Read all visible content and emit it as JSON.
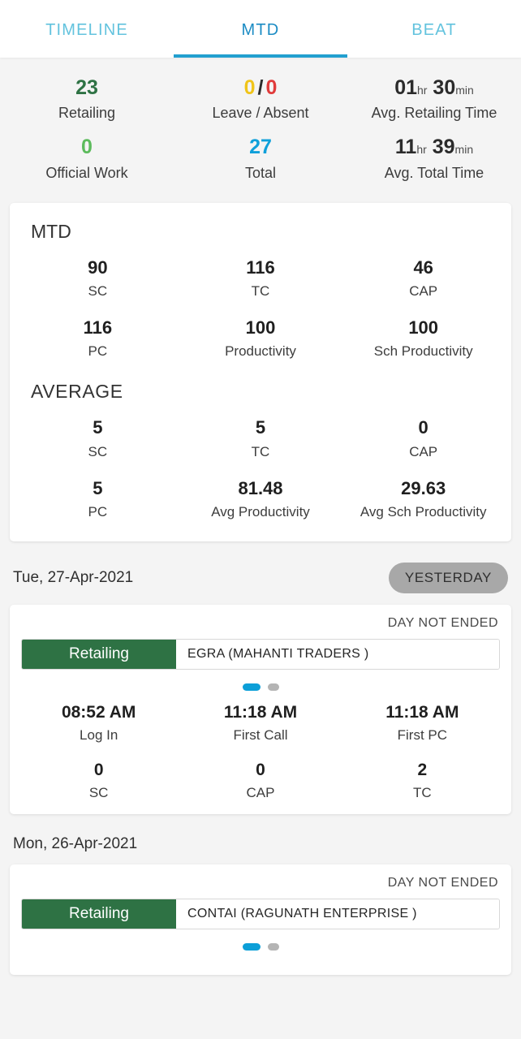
{
  "tabs": [
    {
      "label": "TIMELINE",
      "active": false
    },
    {
      "label": "MTD",
      "active": true
    },
    {
      "label": "BEAT",
      "active": false
    }
  ],
  "summary": {
    "retailing": {
      "value": "23",
      "label": "Retailing",
      "color": "#2e7244"
    },
    "leave_absent": {
      "leave": "0",
      "separator": "/",
      "absent": "0",
      "label": "Leave / Absent",
      "leave_color": "#f0c419",
      "absent_color": "#e03b3b"
    },
    "avg_retailing_time": {
      "hours": "01",
      "hours_unit": "hr",
      "minutes": "30",
      "minutes_unit": "min",
      "label": "Avg. Retailing Time"
    },
    "official_work": {
      "value": "0",
      "label": "Official Work",
      "color": "#5cbb5c"
    },
    "total": {
      "value": "27",
      "label": "Total",
      "color": "#0fa0da"
    },
    "avg_total_time": {
      "hours": "11",
      "hours_unit": "hr",
      "minutes": "39",
      "minutes_unit": "min",
      "label": "Avg. Total Time"
    }
  },
  "mtd_card": {
    "title": "MTD",
    "metrics": [
      {
        "value": "90",
        "label": "SC"
      },
      {
        "value": "116",
        "label": "TC"
      },
      {
        "value": "46",
        "label": "CAP"
      },
      {
        "value": "116",
        "label": "PC"
      },
      {
        "value": "100",
        "label": "Productivity"
      },
      {
        "value": "100",
        "label": "Sch Productivity"
      }
    ],
    "average_title": "AVERAGE",
    "average_metrics": [
      {
        "value": "5",
        "label": "SC"
      },
      {
        "value": "5",
        "label": "TC"
      },
      {
        "value": "0",
        "label": "CAP"
      },
      {
        "value": "5",
        "label": "PC"
      },
      {
        "value": "81.48",
        "label": "Avg Productivity"
      },
      {
        "value": "29.63",
        "label": "Avg Sch Productivity"
      }
    ]
  },
  "days": [
    {
      "date": "Tue, 27-Apr-2021",
      "badge": "YESTERDAY",
      "status": "DAY NOT ENDED",
      "visit_type": "Retailing",
      "visit_name": "EGRA (MAHANTI TRADERS )",
      "dots": [
        {
          "active": true
        },
        {
          "active": false
        }
      ],
      "metrics": [
        {
          "value": "08:52 AM",
          "label": "Log In"
        },
        {
          "value": "11:18 AM",
          "label": "First Call"
        },
        {
          "value": "11:18 AM",
          "label": "First PC"
        },
        {
          "value": "0",
          "label": "SC"
        },
        {
          "value": "0",
          "label": "CAP"
        },
        {
          "value": "2",
          "label": "TC"
        }
      ]
    },
    {
      "date": "Mon, 26-Apr-2021",
      "badge": "",
      "status": "DAY NOT ENDED",
      "visit_type": "Retailing",
      "visit_name": "CONTAI (RAGUNATH ENTERPRISE )",
      "dots": [
        {
          "active": true
        },
        {
          "active": false
        }
      ],
      "metrics": []
    }
  ],
  "colors": {
    "page_background": "#f4f4f4",
    "card_background": "#ffffff",
    "tab_active": "#1c8cc4",
    "tab_inactive": "#63c3de",
    "tab_underline": "#22a0cf",
    "visit_green": "#2e7244",
    "badge_gray": "#a8a8a8",
    "dot_active": "#0c9fd8",
    "dot_inactive": "#b4b4b4"
  }
}
